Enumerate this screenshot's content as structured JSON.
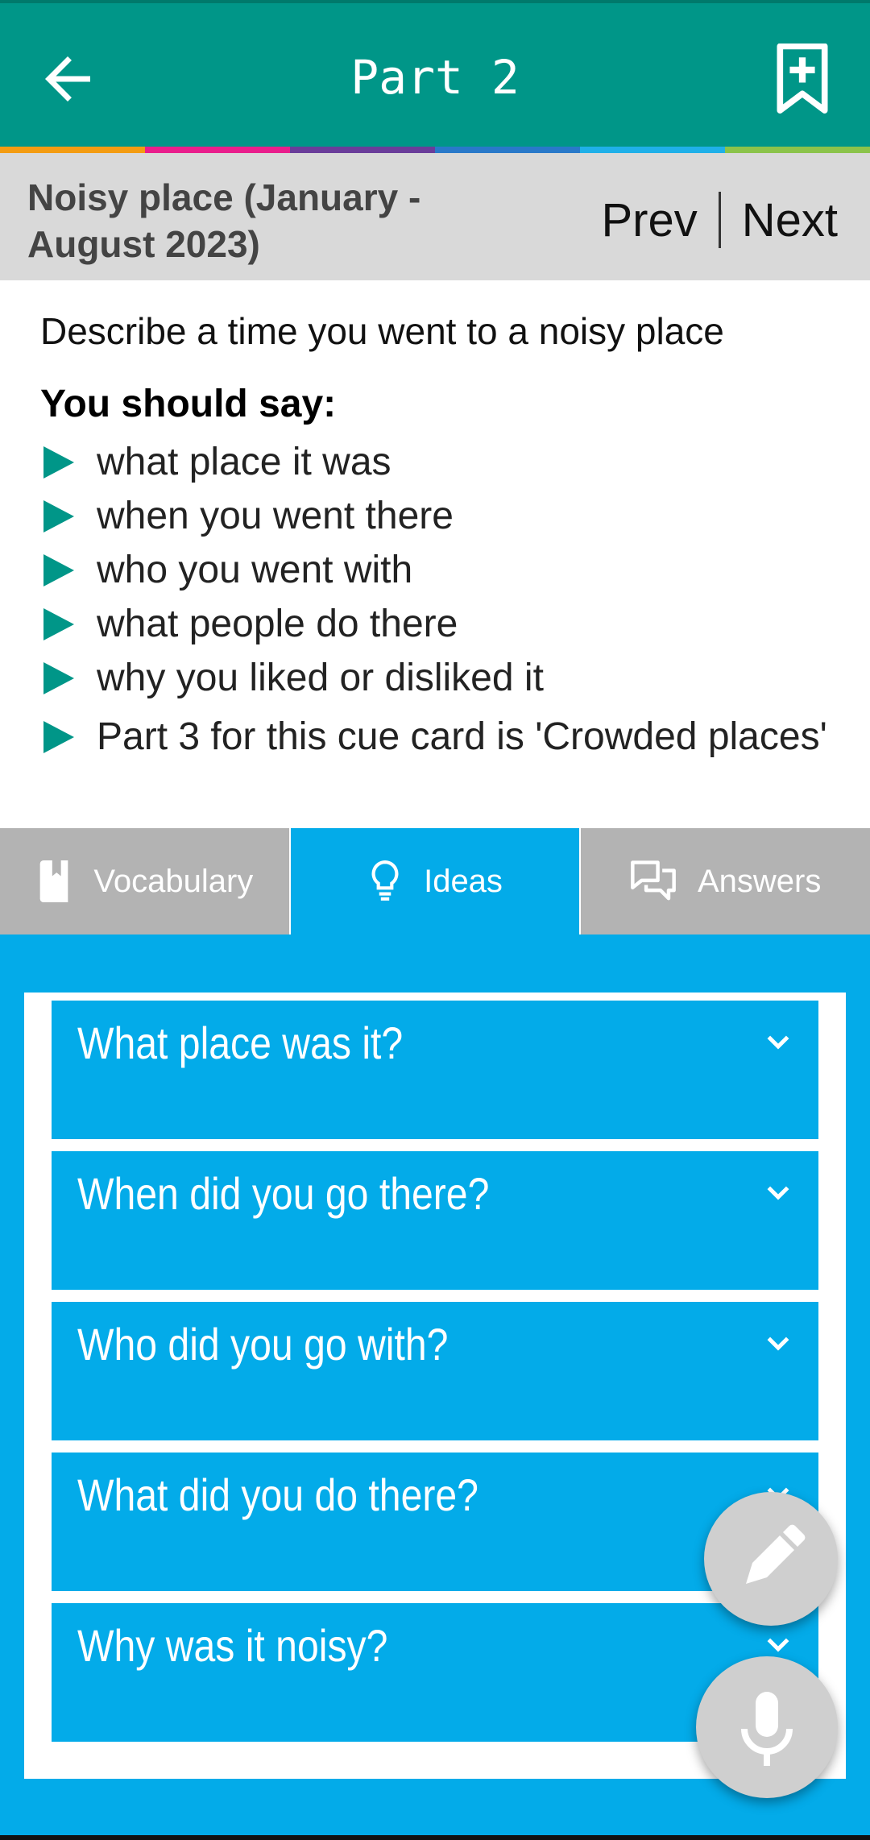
{
  "header": {
    "title": "Part 2",
    "back_icon": "arrow-left-icon",
    "bookmark_icon": "bookmark-add-icon",
    "stripe_colors": [
      "#f39c12",
      "#e91e8c",
      "#6a3d9a",
      "#2979c9",
      "#1fb0e8",
      "#8bc34a"
    ]
  },
  "topic": {
    "title": "Noisy place (January - August 2023)",
    "prev_label": "Prev",
    "next_label": "Next"
  },
  "cue_card": {
    "description": "Describe a time you went to a noisy place",
    "you_should_say": "You should say:",
    "points": [
      "what place it was",
      "when you went there",
      "who you went with",
      "what people do there",
      "why you liked or disliked it",
      "Part 3 for this cue card is 'Crowded places'"
    ]
  },
  "tabs": [
    {
      "label": "Vocabulary",
      "icon": "book-icon",
      "active": false
    },
    {
      "label": "Ideas",
      "icon": "lightbulb-icon",
      "active": true
    },
    {
      "label": "Answers",
      "icon": "chat-bubbles-icon",
      "active": false
    }
  ],
  "ideas": [
    "What place was it?",
    "When did you go there?",
    "Who did you go with?",
    "What did you do there?",
    "Why was it noisy?"
  ],
  "fabs": {
    "edit_icon": "pencil-icon",
    "mic_icon": "microphone-icon"
  },
  "colors": {
    "primary": "#009688",
    "accent": "#03abe9",
    "tab_inactive": "#b3b3b3"
  }
}
